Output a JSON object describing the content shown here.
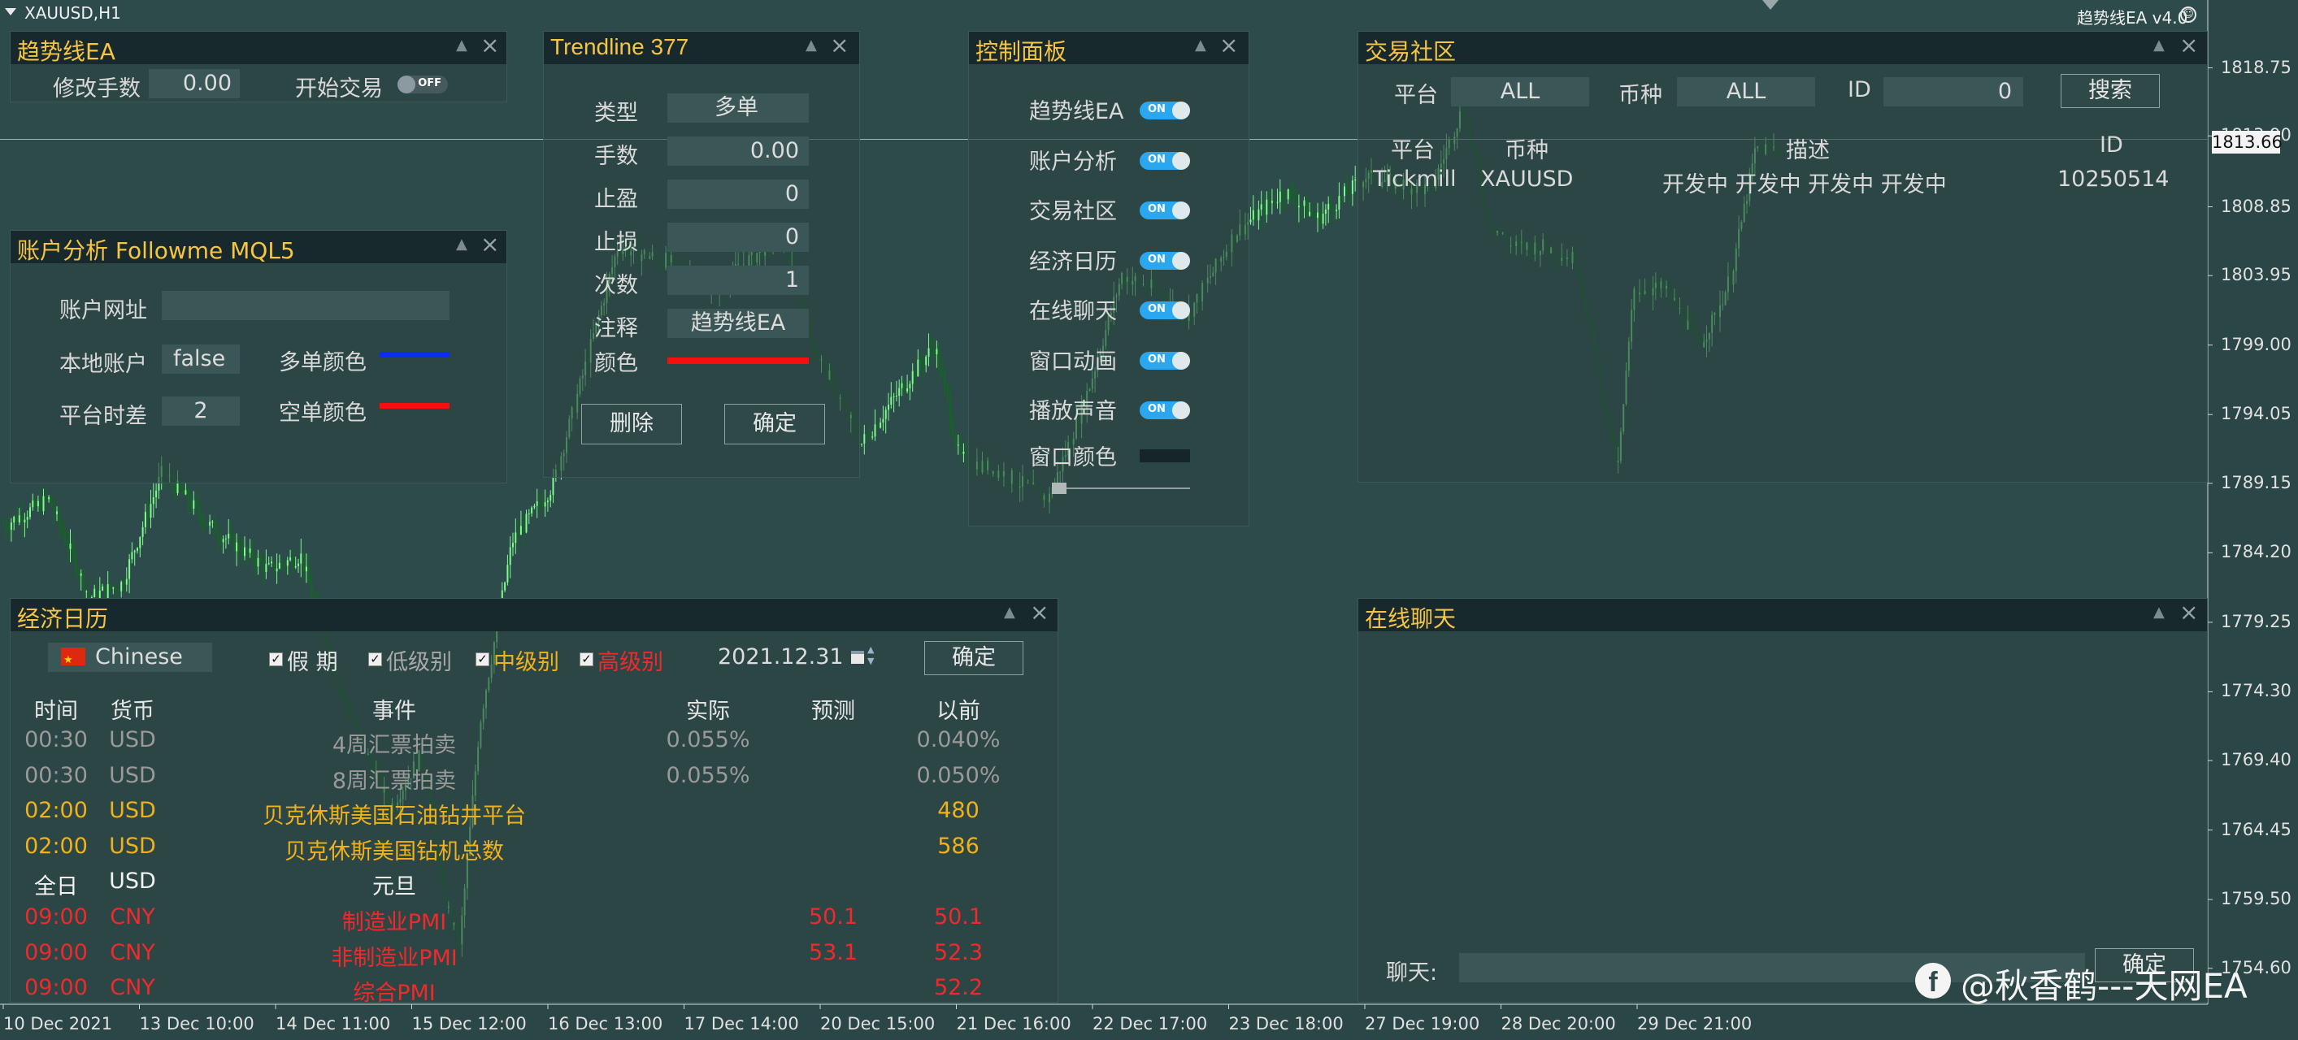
{
  "window": {
    "symbol_title": "XAUUSD,H1",
    "ea_version": "趋势线EA v4.0",
    "price_tag": "1813.66",
    "watermark": "@秋香鹤---天网EA"
  },
  "chart_data": {
    "type": "candlestick",
    "symbol": "XAUUSD",
    "timeframe": "H1",
    "y_ticks": [
      "1818.75",
      "1813.90",
      "1808.85",
      "1803.95",
      "1799.00",
      "1794.05",
      "1789.15",
      "1784.20",
      "1779.25",
      "1774.30",
      "1769.40",
      "1764.45",
      "1759.50",
      "1754.60"
    ],
    "x_ticks": [
      "10 Dec 2021",
      "13 Dec 10:00",
      "14 Dec 11:00",
      "15 Dec 12:00",
      "16 Dec 13:00",
      "17 Dec 14:00",
      "20 Dec 15:00",
      "21 Dec 16:00",
      "22 Dec 17:00",
      "23 Dec 18:00",
      "27 Dec 19:00",
      "28 Dec 20:00",
      "29 Dec 21:00"
    ],
    "ylim": [
      1752.5,
      1821.5
    ],
    "current_price": 1813.66,
    "colors": {
      "background": "#2e4b4b",
      "bull": "#7dfc8c",
      "bear": "#0e6a1a"
    }
  },
  "ea_panel": {
    "title": "趋势线EA",
    "modify_lots_label": "修改手数",
    "modify_lots_value": "0.00",
    "start_trading_label": "开始交易",
    "start_trading_toggle": "OFF"
  },
  "account_panel": {
    "title": "账户分析  Followme  MQL5",
    "url_label": "账户网址",
    "url_value": "",
    "local_label": "本地账户",
    "local_value": "false",
    "tz_label": "平台时差",
    "tz_value": "2",
    "buy_color_label": "多单颜色",
    "sell_color_label": "空单颜色",
    "buy_color": "#0a2cf5",
    "sell_color": "#f50f0f"
  },
  "trendline_panel": {
    "title": "Trendline 377",
    "rows": [
      {
        "label": "类型",
        "value": "多单"
      },
      {
        "label": "手数",
        "value": "0.00"
      },
      {
        "label": "止盈",
        "value": "0"
      },
      {
        "label": "止损",
        "value": "0"
      },
      {
        "label": "次数",
        "value": "1"
      },
      {
        "label": "注释",
        "value": "趋势线EA"
      }
    ],
    "color_label": "颜色",
    "line_color": "#f50f0f",
    "delete_label": "删除",
    "ok_label": "确定"
  },
  "control_panel": {
    "title": "控制面板",
    "rows": [
      {
        "label": "趋势线EA",
        "toggle": "ON"
      },
      {
        "label": "账户分析",
        "toggle": "ON"
      },
      {
        "label": "交易社区",
        "toggle": "ON"
      },
      {
        "label": "经济日历",
        "toggle": "ON"
      },
      {
        "label": "在线聊天",
        "toggle": "ON"
      },
      {
        "label": "窗口动画",
        "toggle": "ON"
      },
      {
        "label": "播放声音",
        "toggle": "ON"
      }
    ],
    "window_color_label": "窗口颜色",
    "window_color": "#16252a"
  },
  "community_panel": {
    "title": "交易社区",
    "platform_label": "平台",
    "platform_value": "ALL",
    "symbol_label": "币种",
    "symbol_value": "ALL",
    "id_label": "ID",
    "id_value": "0",
    "search_label": "搜索",
    "columns": [
      "平台",
      "币种",
      "描述",
      "ID"
    ],
    "rows": [
      {
        "platform": "Tickmill",
        "symbol": "XAUUSD",
        "description": "开发中 开发中 开发中 开发中",
        "id": "10250514"
      }
    ]
  },
  "calendar_panel": {
    "title": "经济日历",
    "country": "Chinese",
    "filters": [
      {
        "label": "假  期",
        "checked": true,
        "color": "#e6e6e6"
      },
      {
        "label": "低级别",
        "checked": true,
        "color": "#a9a9a9"
      },
      {
        "label": "中级别",
        "checked": true,
        "color": "#f0b21a"
      },
      {
        "label": "高级别",
        "checked": true,
        "color": "#f02a2a"
      }
    ],
    "date": "2021.12.31",
    "ok_label": "确定",
    "columns": [
      "时间",
      "货币",
      "事件",
      "实际",
      "预测",
      "以前"
    ],
    "rows": [
      {
        "time": "00:30",
        "currency": "USD",
        "event": "4周汇票拍卖",
        "actual": "0.055%",
        "forecast": "",
        "previous": "0.040%",
        "color": "#9a9a9a"
      },
      {
        "time": "00:30",
        "currency": "USD",
        "event": "8周汇票拍卖",
        "actual": "0.055%",
        "forecast": "",
        "previous": "0.050%",
        "color": "#9a9a9a"
      },
      {
        "time": "02:00",
        "currency": "USD",
        "event": "贝克休斯美国石油钻井平台",
        "actual": "",
        "forecast": "",
        "previous": "480",
        "color": "#f0b21a"
      },
      {
        "time": "02:00",
        "currency": "USD",
        "event": "贝克休斯美国钻机总数",
        "actual": "",
        "forecast": "",
        "previous": "586",
        "color": "#f0b21a"
      },
      {
        "time": "全日",
        "currency": "USD",
        "event": "元旦",
        "actual": "",
        "forecast": "",
        "previous": "",
        "color": "#f2f2f2"
      },
      {
        "time": "09:00",
        "currency": "CNY",
        "event": "制造业PMI",
        "actual": "",
        "forecast": "50.1",
        "previous": "50.1",
        "color": "#f02a2a"
      },
      {
        "time": "09:00",
        "currency": "CNY",
        "event": "非制造业PMI",
        "actual": "",
        "forecast": "53.1",
        "previous": "52.3",
        "color": "#f02a2a"
      },
      {
        "time": "09:00",
        "currency": "CNY",
        "event": "综合PMI",
        "actual": "",
        "forecast": "",
        "previous": "52.2",
        "color": "#f02a2a"
      }
    ]
  },
  "chat_panel": {
    "title": "在线聊天",
    "chat_label": "聊天:",
    "chat_value": "",
    "send_label": "确定"
  }
}
